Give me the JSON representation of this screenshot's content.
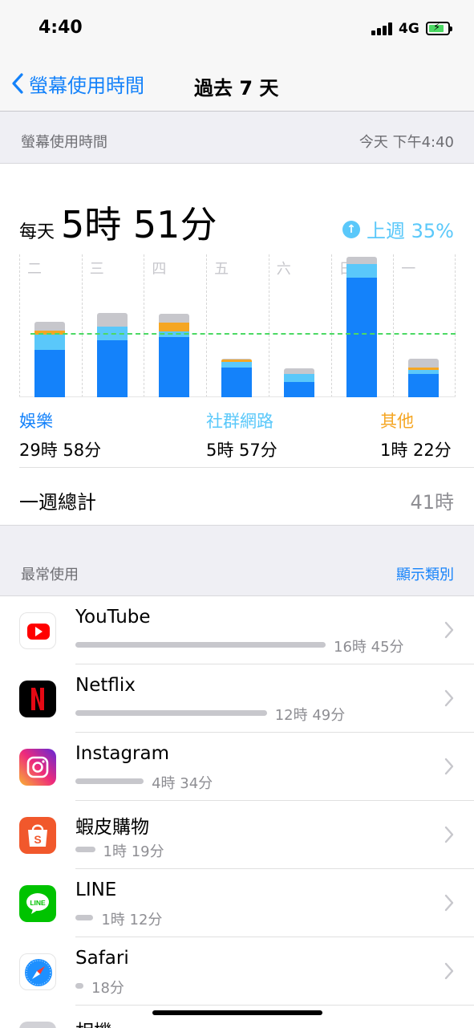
{
  "status": {
    "time": "4:40",
    "network": "4G"
  },
  "nav": {
    "back_label": "螢幕使用時間",
    "title": "過去 7 天"
  },
  "summary_header": {
    "left": "螢幕使用時間",
    "right": "今天 下午4:40"
  },
  "summary": {
    "daily_label": "每天",
    "daily_value": "5時 51分",
    "trend_text": "上週 35%",
    "categories": [
      {
        "name": "娛樂",
        "time": "29時 58分",
        "color": "#1482fa"
      },
      {
        "name": "社群網路",
        "time": "5時 57分",
        "color": "#5ac8fa"
      },
      {
        "name": "其他",
        "time": "1時 22分",
        "color": "#f5a623"
      }
    ],
    "week_total_label": "一週總計",
    "week_total_value": "41時"
  },
  "chart_data": {
    "type": "bar",
    "stacked": true,
    "categories": [
      "二",
      "三",
      "四",
      "五",
      "六",
      "日",
      "一"
    ],
    "series": [
      {
        "name": "娛樂",
        "color": "#1482fa",
        "values": [
          4.3,
          5.2,
          5.5,
          2.7,
          1.4,
          10.9,
          2.1
        ]
      },
      {
        "name": "社群網路",
        "color": "#5ac8fa",
        "values": [
          1.4,
          1.2,
          0.5,
          0.5,
          0.7,
          1.2,
          0.4
        ]
      },
      {
        "name": "其他",
        "color": "#f5a623",
        "values": [
          0.4,
          0.05,
          0.8,
          0.2,
          0.05,
          0.05,
          0.2
        ]
      },
      {
        "name": "",
        "color": "#c7c7cc",
        "values": [
          0.8,
          1.2,
          0.8,
          0.1,
          0.5,
          0.6,
          0.8
        ]
      }
    ],
    "average": 5.85,
    "ylim": [
      0,
      13
    ],
    "grid": true
  },
  "most_used_header": {
    "left": "最常使用",
    "right": "顯示類別"
  },
  "apps": [
    {
      "name": "YouTube",
      "time": "16時 45分",
      "minutes": 1005
    },
    {
      "name": "Netflix",
      "time": "12時 49分",
      "minutes": 769
    },
    {
      "name": "Instagram",
      "time": "4時 34分",
      "minutes": 274
    },
    {
      "name": "蝦皮購物",
      "time": "1時 19分",
      "minutes": 79
    },
    {
      "name": "LINE",
      "time": "1時 12分",
      "minutes": 72
    },
    {
      "name": "Safari",
      "time": "18分",
      "minutes": 18
    },
    {
      "name": "相機",
      "time": "",
      "minutes": 0
    }
  ]
}
